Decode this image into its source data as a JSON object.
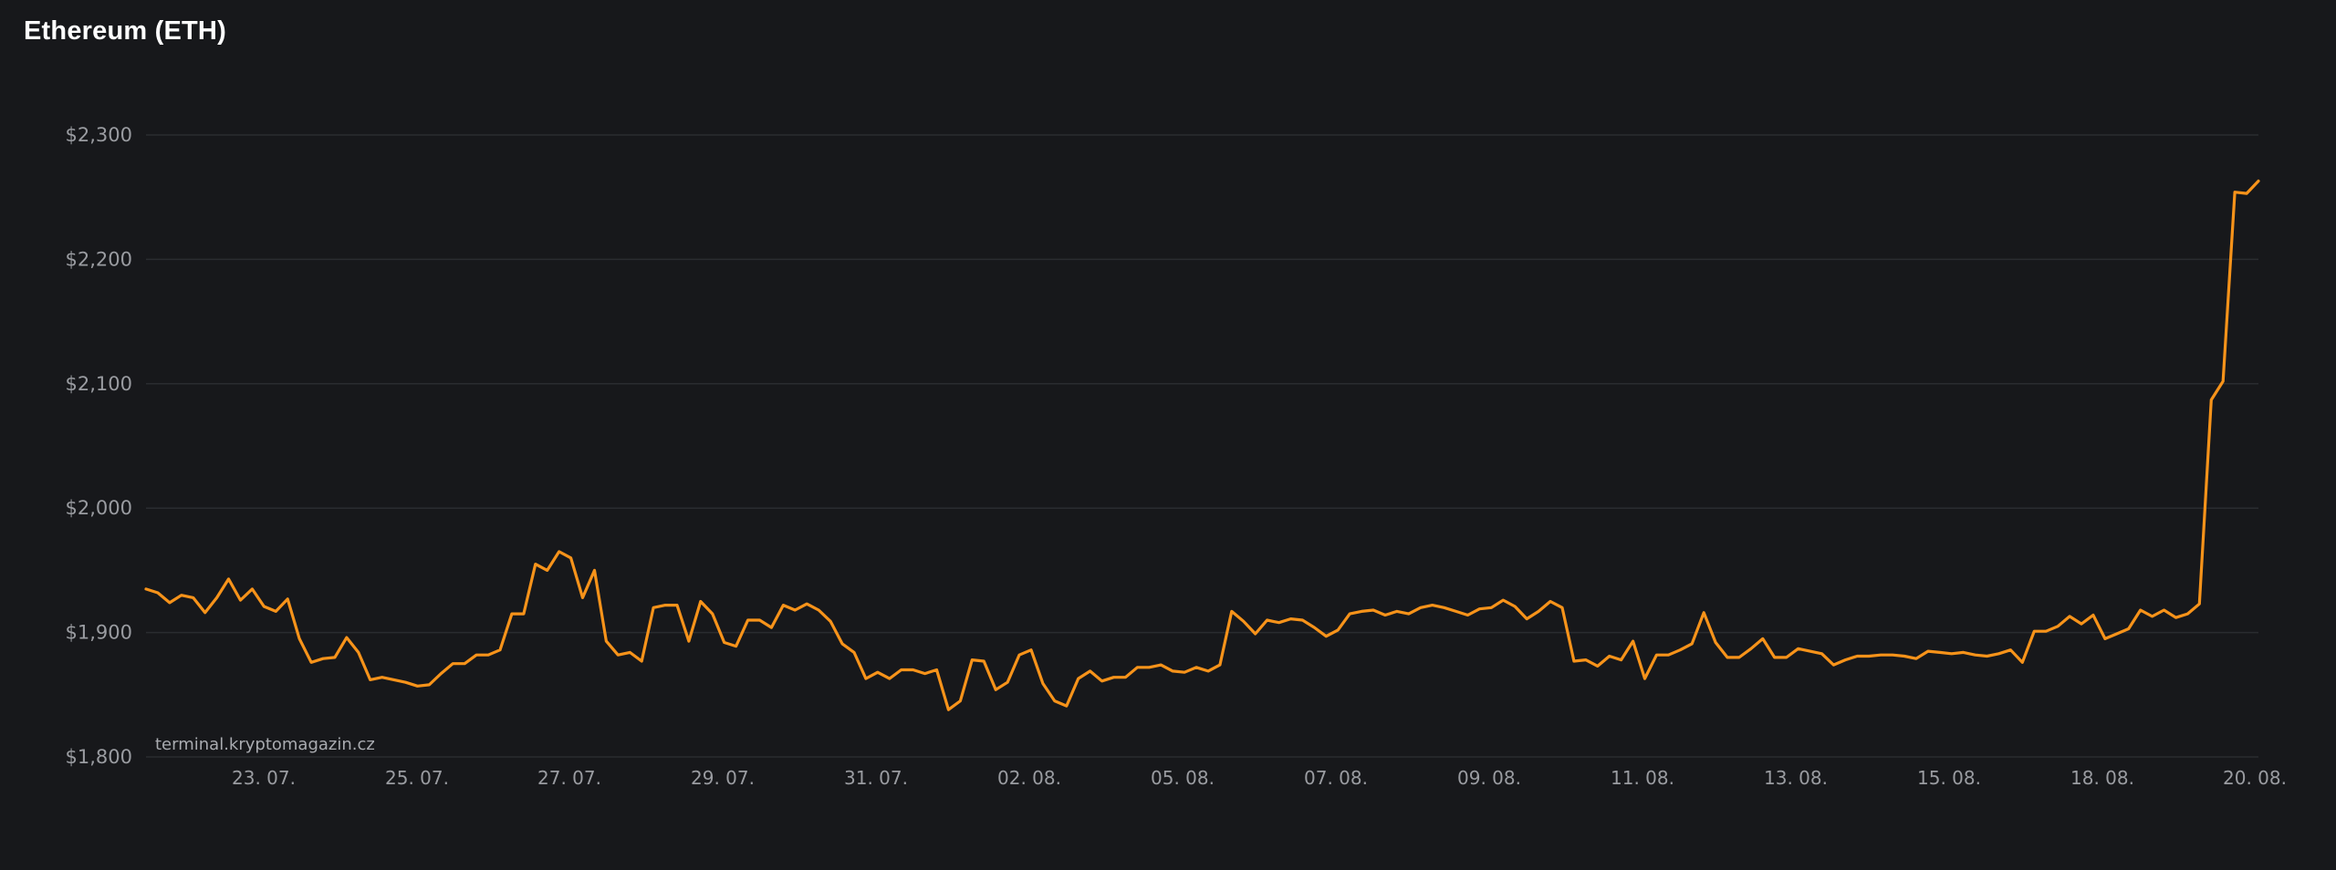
{
  "chart_data": {
    "type": "line",
    "title": "Ethereum (ETH)",
    "xlabel": "",
    "ylabel": "",
    "ylim": [
      1800,
      2300
    ],
    "y_ticks": [
      "$1,800",
      "$1,900",
      "$2,000",
      "$2,100",
      "$2,200",
      "$2,300"
    ],
    "y_tick_values": [
      1800,
      1900,
      2000,
      2100,
      2200,
      2300
    ],
    "x_tick_labels": [
      "23. 07.",
      "25. 07.",
      "27. 07.",
      "29. 07.",
      "31. 07.",
      "02. 08.",
      "05. 08.",
      "07. 08.",
      "09. 08.",
      "11. 08.",
      "13. 08.",
      "15. 08.",
      "18. 08.",
      "20. 08."
    ],
    "grid": true,
    "legend": "none",
    "line_color": "#f7931a",
    "watermark": "terminal.kryptomagazin.cz",
    "series": [
      {
        "values": [
          1935,
          1932,
          1924,
          1930,
          1928,
          1916,
          1928,
          1943,
          1926,
          1935,
          1921,
          1917,
          1927,
          1895,
          1876,
          1879,
          1880,
          1896,
          1884,
          1862,
          1864,
          1862,
          1860,
          1857,
          1858,
          1867,
          1875,
          1875,
          1882,
          1882,
          1886,
          1915,
          1915,
          1955,
          1950,
          1965,
          1960,
          1928,
          1950,
          1893,
          1882,
          1884,
          1877,
          1920,
          1922,
          1922,
          1893,
          1925,
          1915,
          1892,
          1889,
          1910,
          1910,
          1904,
          1922,
          1918,
          1923,
          1918,
          1909,
          1891,
          1884,
          1863,
          1868,
          1863,
          1870,
          1870,
          1867,
          1870,
          1838,
          1845,
          1878,
          1877,
          1854,
          1860,
          1882,
          1886,
          1859,
          1845,
          1841,
          1863,
          1869,
          1861,
          1864,
          1864,
          1872,
          1872,
          1874,
          1869,
          1868,
          1872,
          1869,
          1874,
          1917,
          1909,
          1899,
          1910,
          1908,
          1911,
          1910,
          1904,
          1897,
          1902,
          1915,
          1917,
          1918,
          1914,
          1917,
          1915,
          1920,
          1922,
          1920,
          1917,
          1914,
          1919,
          1920,
          1926,
          1921,
          1911,
          1917,
          1925,
          1920,
          1877,
          1878,
          1873,
          1881,
          1878,
          1893,
          1863,
          1882,
          1882,
          1886,
          1891,
          1916,
          1892,
          1880,
          1880,
          1887,
          1895,
          1880,
          1880,
          1887,
          1885,
          1883,
          1874,
          1878,
          1881,
          1881,
          1882,
          1882,
          1881,
          1879,
          1885,
          1884,
          1883,
          1884,
          1882,
          1881,
          1883,
          1886,
          1876,
          1901,
          1901,
          1905,
          1913,
          1907,
          1914,
          1895,
          1899,
          1903,
          1918,
          1913,
          1918,
          1912,
          1915,
          1923,
          2087,
          2102,
          2254,
          2253,
          2263
        ]
      }
    ]
  }
}
